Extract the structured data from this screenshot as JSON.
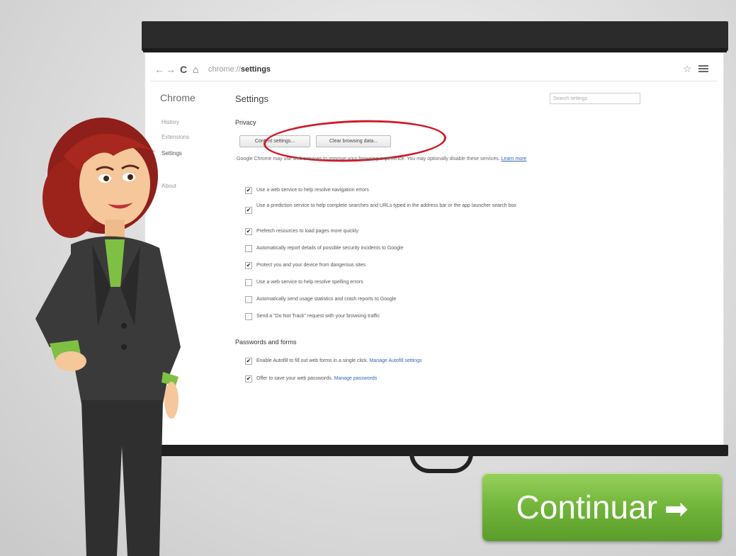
{
  "browser": {
    "url_host": "chrome://",
    "url_path": "settings"
  },
  "sidebar": {
    "title": "Chrome",
    "items": [
      "History",
      "Extensions",
      "Settings",
      "About"
    ]
  },
  "main": {
    "title": "Settings",
    "search_placeholder": "Search settings",
    "privacy": {
      "heading": "Privacy",
      "content_settings_button": "Content settings...",
      "clear_browsing_button": "Clear browsing data...",
      "description": "Google Chrome may use web services to improve your browsing experience. You may optionally disable these services.",
      "learn_more": "Learn more",
      "options": [
        {
          "label": "Use a web service to help resolve navigation errors",
          "checked": true
        },
        {
          "label": "Use a prediction service to help complete searches and URLs typed in the address bar or the app launcher search box",
          "checked": true
        },
        {
          "label": "Prefetch resources to load pages more quickly",
          "checked": true
        },
        {
          "label": "Automatically report details of possible security incidents to Google",
          "checked": false
        },
        {
          "label": "Protect you and your device from dangerous sites",
          "checked": true
        },
        {
          "label": "Use a web service to help resolve spelling errors",
          "checked": false
        },
        {
          "label": "Automatically send usage statistics and crash reports to Google",
          "checked": false
        },
        {
          "label": "Send a \"Do Not Track\" request with your browsing traffic",
          "checked": false
        }
      ]
    },
    "passwords": {
      "heading": "Passwords and forms",
      "options": [
        {
          "label": "Enable Autofill to fill out web forms in a single click.",
          "link": "Manage Autofill settings",
          "checked": true
        },
        {
          "label": "Offer to save your web passwords.",
          "link": "Manage passwords",
          "checked": true
        }
      ]
    }
  },
  "continue_button": {
    "label": "Continuar",
    "arrow": "➡"
  },
  "colors": {
    "highlight": "#d01a28",
    "continue_green": "#74b73c",
    "screen_frame": "#2b2b2b"
  }
}
